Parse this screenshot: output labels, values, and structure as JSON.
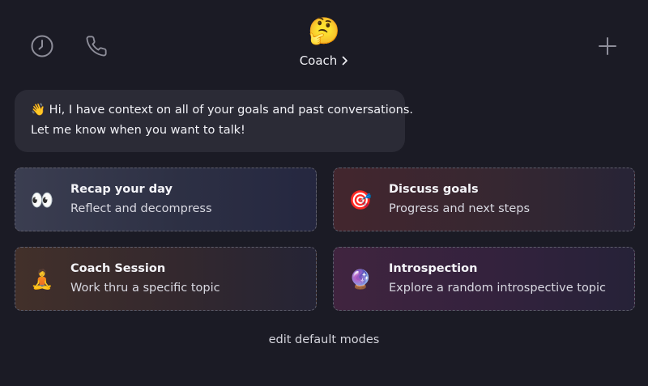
{
  "header": {
    "history_icon": "clock-icon",
    "call_icon": "phone-icon",
    "new_icon": "plus-icon",
    "persona": {
      "emoji": "🤔",
      "name": "Coach",
      "chevron_icon": "chevron-right-icon"
    }
  },
  "message": {
    "line1": "👋 Hi, I have context on all of your goals and past conversations.",
    "line2": "Let me know when you want to talk!"
  },
  "modes": [
    {
      "emoji": "👀",
      "title": "Recap your day",
      "description": "Reflect and decompress"
    },
    {
      "emoji": "🎯",
      "title": "Discuss goals",
      "description": "Progress and next steps"
    },
    {
      "emoji": "🧘",
      "title": "Coach Session",
      "description": "Work thru a specific topic"
    },
    {
      "emoji": "🔮",
      "title": "Introspection",
      "description": "Explore a random introspective topic"
    }
  ],
  "footer": {
    "edit_label": "edit default modes"
  },
  "colors": {
    "background": "#1b1b25",
    "bubble": "#2b2b36",
    "icon_gray": "#8e8e9a",
    "card_border": "#5e5e6c"
  }
}
